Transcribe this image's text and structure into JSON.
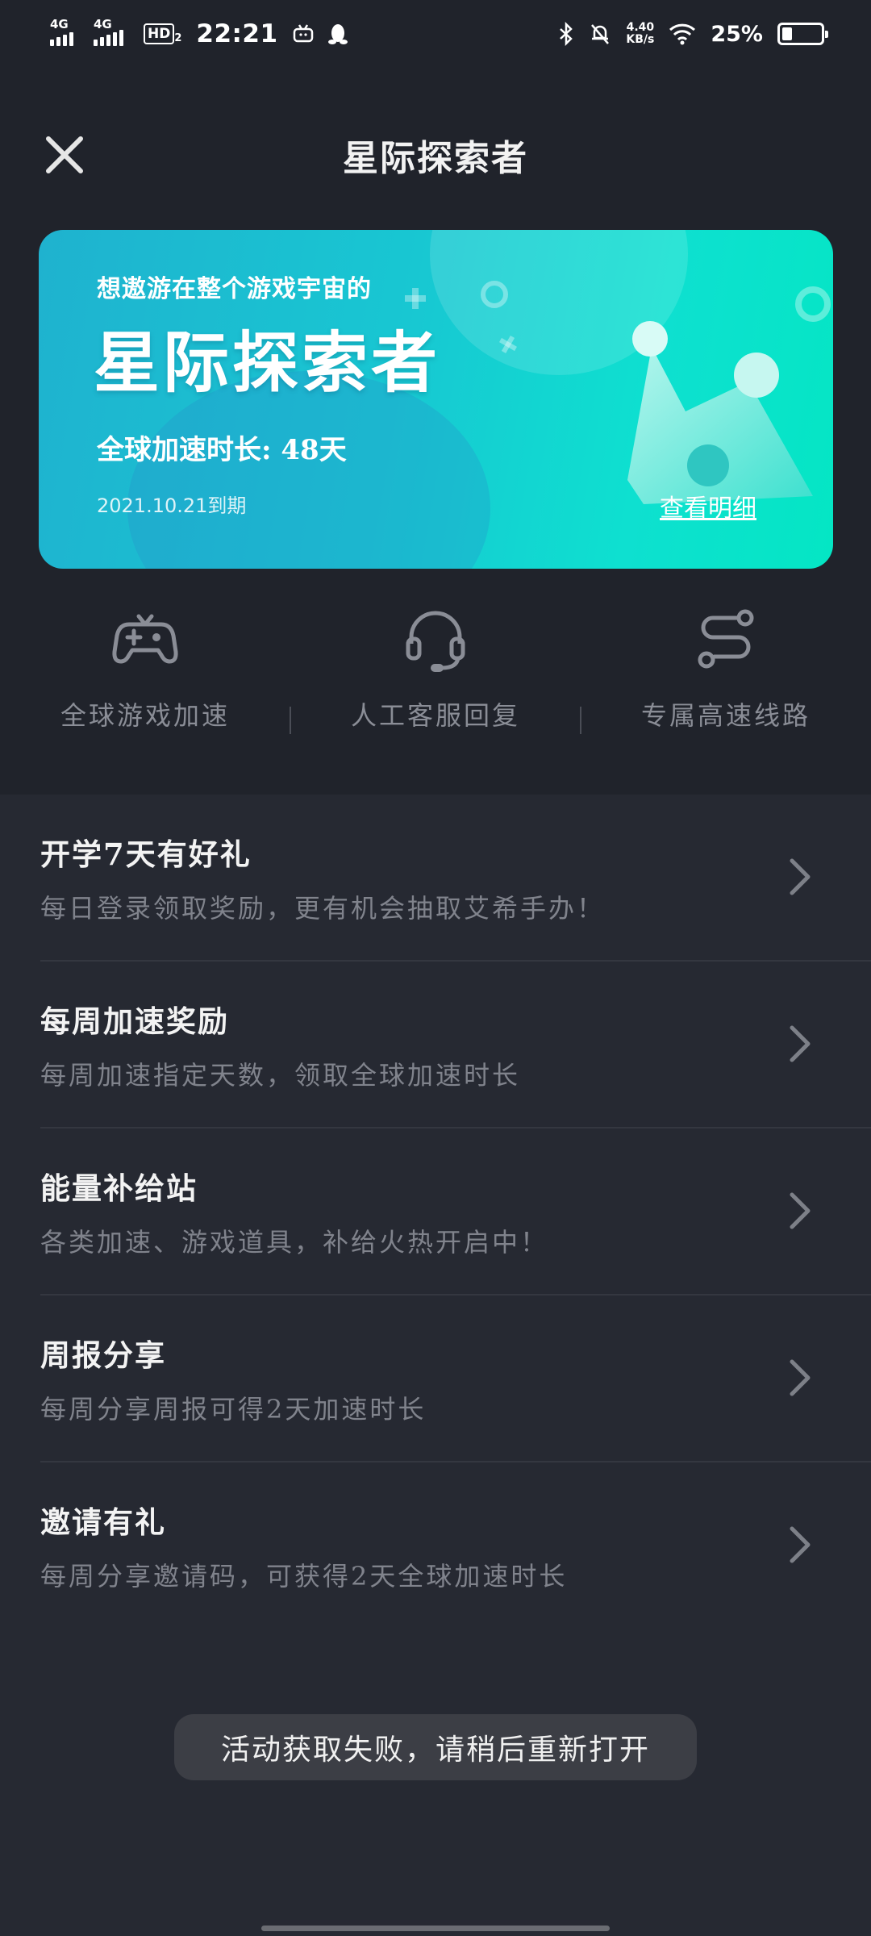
{
  "status_bar": {
    "network1": "4G",
    "network2": "4G",
    "hd": "HD",
    "hd_sub": "2",
    "time": "22:21",
    "net_speed_value": "4.40",
    "net_speed_unit": "KB/s",
    "battery_text": "25%",
    "battery_level": 0.25
  },
  "header": {
    "title": "星际探索者"
  },
  "banner": {
    "subtitle": "想遨游在整个游戏宇宙的",
    "title": "星际探索者",
    "duration": "全球加速时长: 48天",
    "expire": "2021.10.21到期",
    "link": "查看明细"
  },
  "features": [
    {
      "label": "全球游戏加速",
      "icon": "gamepad-icon"
    },
    {
      "label": "人工客服回复",
      "icon": "headset-icon"
    },
    {
      "label": "专属高速线路",
      "icon": "route-icon"
    }
  ],
  "list": [
    {
      "title": "开学7天有好礼",
      "desc": "每日登录领取奖励，更有机会抽取艾希手办！"
    },
    {
      "title": "每周加速奖励",
      "desc": "每周加速指定天数，领取全球加速时长"
    },
    {
      "title": "能量补给站",
      "desc": "各类加速、游戏道具，补给火热开启中！"
    },
    {
      "title": "周报分享",
      "desc": "每周分享周报可得2天加速时长"
    },
    {
      "title": "邀请有礼",
      "desc": "每周分享邀请码，可获得2天全球加速时长"
    }
  ],
  "toast": "活动获取失败，请稍后重新打开",
  "colors": {
    "background": "#262932",
    "banner_gradient_start": "#1fb2cf",
    "banner_gradient_end": "#04e6c4",
    "muted_text": "#80838c"
  }
}
